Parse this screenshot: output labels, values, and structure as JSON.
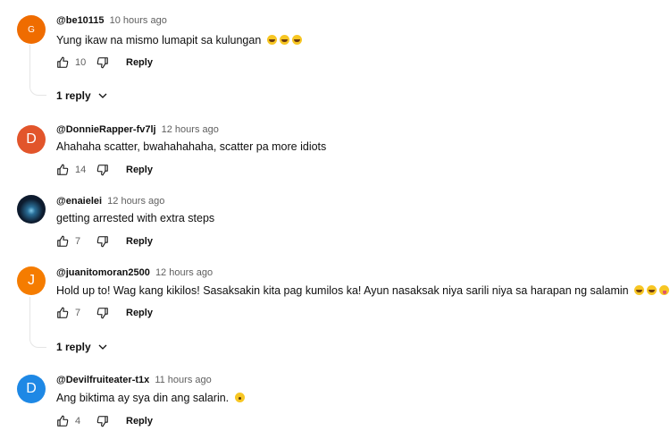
{
  "comments": [
    {
      "avatar_letter": "G",
      "avatar_color": "#ef6c00",
      "handle": "@be10115",
      "time": "10 hours ago",
      "text": "Yung ikaw na mismo lumapit sa kulungan",
      "emojis": [
        "rofl",
        "rofl",
        "rofl"
      ],
      "likes": "10",
      "reply_label": "Reply",
      "replies_label": "1 reply"
    },
    {
      "avatar_letter": "D",
      "avatar_color": "#e2552b",
      "handle": "@DonnieRapper-fv7lj",
      "time": "12 hours ago",
      "text": "Ahahaha scatter, bwahahahaha, scatter pa more idiots",
      "likes": "14",
      "reply_label": "Reply"
    },
    {
      "avatar_letter": "",
      "avatar_color": "#0d1b2e",
      "handle": "@enaielei",
      "time": "12 hours ago",
      "text": "getting arrested with extra steps",
      "likes": "7",
      "reply_label": "Reply"
    },
    {
      "avatar_letter": "J",
      "avatar_color": "#f57c00",
      "handle": "@juanitomoran2500",
      "time": "12 hours ago",
      "text": "Hold up to! Wag kang kikilos! Sasaksakin kita pag kumilos ka! Ayun nasaksak niya sarili niya sa harapan ng salamin",
      "emojis": [
        "joy",
        "rofl",
        "zany"
      ],
      "likes": "7",
      "reply_label": "Reply",
      "replies_label": "1 reply"
    },
    {
      "avatar_letter": "D",
      "avatar_color": "#1e88e5",
      "handle": "@Devilfruiteater-t1x",
      "time": "11 hours ago",
      "text": "Ang biktima ay sya din ang salarin.",
      "emojis": [
        "wow"
      ],
      "likes": "4",
      "reply_label": "Reply"
    }
  ],
  "icons": {
    "like": "thumb-up-icon",
    "dislike": "thumb-down-icon",
    "expand": "chevron-down-icon"
  }
}
